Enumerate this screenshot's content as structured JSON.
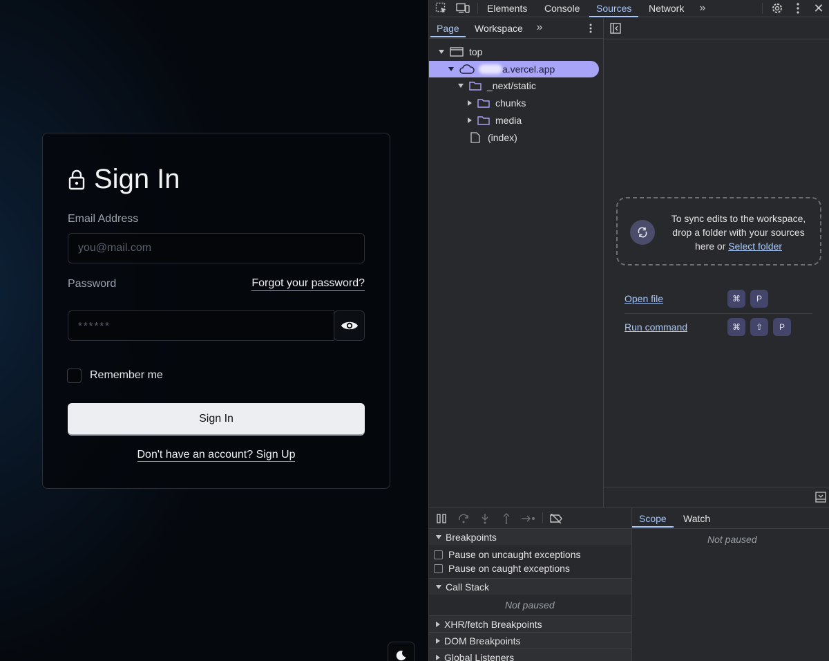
{
  "login": {
    "title": "Sign In",
    "email_label": "Email Address",
    "email_placeholder": "you@mail.com",
    "password_label": "Password",
    "forgot_link": "Forgot your password?",
    "password_placeholder": "******",
    "remember_label": "Remember me",
    "submit_label": "Sign In",
    "signup_link": "Don't have an account? Sign Up"
  },
  "devtools": {
    "tabs": [
      "Elements",
      "Console",
      "Sources",
      "Network"
    ],
    "active_tab": "Sources",
    "sub_tabs": [
      "Page",
      "Workspace"
    ],
    "tree": {
      "top": "top",
      "domain": "a.vercel.app",
      "next_static": "_next/static",
      "chunks": "chunks",
      "media": "media",
      "index": "(index)"
    },
    "workspace_hint_line1": "To sync edits to the workspace,",
    "workspace_hint_line2": "drop a folder with your sources",
    "workspace_hint_line3": "here or",
    "select_folder": "Select folder",
    "open_file": "Open file",
    "run_command": "Run command",
    "keys": {
      "cmd": "⌘",
      "shift": "⇧",
      "p": "P"
    },
    "debugger": {
      "breakpoints": "Breakpoints",
      "pause_uncaught": "Pause on uncaught exceptions",
      "pause_caught": "Pause on caught exceptions",
      "call_stack": "Call Stack",
      "not_paused": "Not paused",
      "xhr": "XHR/fetch Breakpoints",
      "dom": "DOM Breakpoints",
      "global": "Global Listeners"
    },
    "scope_tabs": [
      "Scope",
      "Watch"
    ],
    "scope_not_paused": "Not paused"
  },
  "colors": {
    "accent": "#a8c7fa",
    "selection": "#a8a4f8",
    "app_bg": "#05080d"
  }
}
